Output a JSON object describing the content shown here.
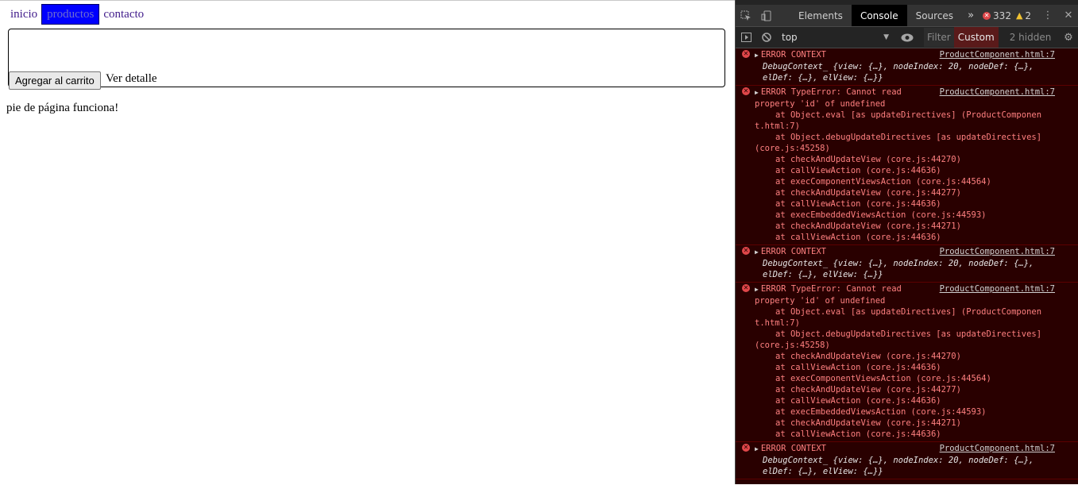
{
  "page": {
    "nav": [
      {
        "label": "inicio",
        "active": false
      },
      {
        "label": "productos",
        "active": true
      },
      {
        "label": "contacto",
        "active": false
      }
    ],
    "card": {
      "button_label": "Agregar al carrito",
      "link_label": "Ver detalle"
    },
    "footer_text": "pie de página funciona!"
  },
  "devtools": {
    "tabs": [
      "Elements",
      "Console",
      "Sources"
    ],
    "active_tab": "Console",
    "more_tabs": "»",
    "error_count": "332",
    "warning_count": "2",
    "context": "top",
    "filter_placeholder": "Filter",
    "levels_label": "Custom",
    "hidden_label": "2 hidden",
    "messages": {
      "m1": {
        "title": "ERROR CONTEXT",
        "source": "ProductComponent.html:7",
        "line1": "DebugContext_ {view: {…}, nodeIndex: 20, nodeDef: {…},",
        "line2": "elDef: {…}, elView: {…}}"
      },
      "m2": {
        "title": "ERROR TypeError: Cannot read",
        "source": "ProductComponent.html:7",
        "title2": "property 'id' of undefined",
        "stack": [
          "at Object.eval [as updateDirectives] (ProductComponen",
          "t.html:7)",
          "at Object.debugUpdateDirectives [as updateDirectives]",
          "(core.js:45258)",
          "at checkAndUpdateView (core.js:44270)",
          "at callViewAction (core.js:44636)",
          "at execComponentViewsAction (core.js:44564)",
          "at checkAndUpdateView (core.js:44277)",
          "at callViewAction (core.js:44636)",
          "at execEmbeddedViewsAction (core.js:44593)",
          "at checkAndUpdateView (core.js:44271)",
          "at callViewAction (core.js:44636)"
        ]
      },
      "m3": {
        "title": "ERROR CONTEXT",
        "source": "ProductComponent.html:7",
        "line1": "DebugContext_ {view: {…}, nodeIndex: 20, nodeDef: {…},",
        "line2": "elDef: {…}, elView: {…}}"
      },
      "m4": {
        "title": "ERROR TypeError: Cannot read",
        "source": "ProductComponent.html:7",
        "title2": "property 'id' of undefined",
        "stack": [
          "at Object.eval [as updateDirectives] (ProductComponen",
          "t.html:7)",
          "at Object.debugUpdateDirectives [as updateDirectives]",
          "(core.js:45258)",
          "at checkAndUpdateView (core.js:44270)",
          "at callViewAction (core.js:44636)",
          "at execComponentViewsAction (core.js:44564)",
          "at checkAndUpdateView (core.js:44277)",
          "at callViewAction (core.js:44636)",
          "at execEmbeddedViewsAction (core.js:44593)",
          "at checkAndUpdateView (core.js:44271)",
          "at callViewAction (core.js:44636)"
        ]
      },
      "m5": {
        "title": "ERROR CONTEXT",
        "source": "ProductComponent.html:7",
        "line1": "DebugContext_ {view: {…}, nodeIndex: 20, nodeDef: {…},",
        "line2": "elDef: {…}, elView: {…}}"
      }
    }
  }
}
